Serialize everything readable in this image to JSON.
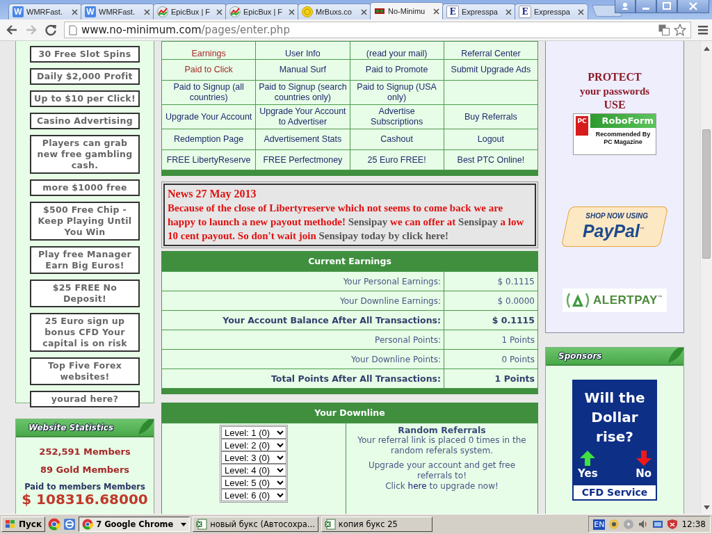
{
  "browser": {
    "tabs": [
      {
        "title": "WMRFast.",
        "kind": "letter",
        "favicon_text": "W",
        "selected": false
      },
      {
        "title": "WMRFast.",
        "kind": "letter",
        "favicon_text": "W",
        "selected": false
      },
      {
        "title": "EpicBux | F",
        "kind": "chart",
        "selected": false
      },
      {
        "title": "EpicBux | F",
        "kind": "chart",
        "selected": false
      },
      {
        "title": "MrBuxs.co",
        "kind": "coin",
        "selected": false
      },
      {
        "title": "No-Minimu",
        "kind": "flag",
        "selected": true
      },
      {
        "title": "Expresspa",
        "kind": "serif",
        "favicon_text": "E",
        "selected": false
      },
      {
        "title": "Expresspa",
        "kind": "serif",
        "favicon_text": "E",
        "selected": false
      }
    ],
    "back_enabled": true,
    "forward_enabled": false,
    "url_host": "www.no-minimum.com",
    "url_path": "/pages/enter.php"
  },
  "left_ads": [
    "30 Free Slot Spins",
    "Daily $2,000 Profit",
    "Up to $10 per Click!",
    "Casino Advertising",
    "Players can grab new free gambling cash.",
    "more $1000 free",
    "$500 Free Chip - Keep Playing Until You Win",
    "Play free Manager Earn Big Euros!",
    "$25 FREE No Deposit!",
    "25 Euro sign up bonus CFD Your capital is on risk",
    "Top Five Forex websites!",
    "yourad here?"
  ],
  "stats": {
    "title": "Website Statistics",
    "members": "252,591 Members",
    "gold": "89 Gold Members",
    "paid_label": "Paid to members Members",
    "paid_value": "$ 108316.68000"
  },
  "nav": {
    "rows": [
      [
        {
          "kind": "link",
          "text": "Earnings",
          "visited": true
        },
        {
          "kind": "link",
          "text": "User Info",
          "visited": false
        },
        {
          "kind": "link",
          "text": "(read your mail)",
          "visited": false
        },
        {
          "kind": "link",
          "text": "Referral Center",
          "visited": false
        }
      ],
      [
        {
          "kind": "link",
          "text": "Paid to Click",
          "visited": true
        },
        {
          "kind": "link",
          "text": "Manual Surf",
          "visited": false
        },
        {
          "kind": "link",
          "text": "Paid to Promote",
          "visited": false
        },
        {
          "kind": "link",
          "text": "Submit Upgrade Ads",
          "visited": false
        }
      ],
      [
        {
          "kind": "link",
          "text": "Paid to Signup (all countries)",
          "visited": false
        },
        {
          "kind": "link",
          "text": "Paid to Signup (search countries only)",
          "visited": false
        },
        {
          "kind": "link",
          "text": "Paid to Signup (USA only)",
          "visited": false
        },
        {
          "kind": "blank"
        }
      ],
      [
        {
          "kind": "link",
          "text": "Upgrade Your Account",
          "visited": false
        },
        {
          "kind": "link",
          "text": "Upgrade Your Account to Advertiser",
          "visited": false
        },
        {
          "kind": "link",
          "text": "Advertise Subscriptions",
          "visited": false
        },
        {
          "kind": "link",
          "text": "Buy Referrals",
          "visited": false
        }
      ],
      [
        {
          "kind": "link",
          "text": "Redemption Page",
          "visited": false
        },
        {
          "kind": "link",
          "text": "Advertisement Stats",
          "visited": false
        },
        {
          "kind": "link",
          "text": "Cashout",
          "visited": false
        },
        {
          "kind": "link",
          "text": "Logout",
          "visited": false
        }
      ],
      [
        {
          "kind": "link",
          "text": "FREE LibertyReserve",
          "visited": false
        },
        {
          "kind": "link",
          "text": "FREE Perfectmoney",
          "visited": false
        },
        {
          "kind": "link",
          "text": "25 Euro FREE!",
          "visited": false
        },
        {
          "kind": "link",
          "text": "Best PTC Online!",
          "visited": false
        }
      ]
    ]
  },
  "news": {
    "title": "News 27 May 2013",
    "segments": [
      {
        "kind": "alert",
        "text": "Because of the close of Libertyreserve which not seems to come back we are happy to launch a new payout methode! "
      },
      {
        "kind": "link",
        "text": "Sensipay"
      },
      {
        "kind": "alert",
        "text": " we can offer at "
      },
      {
        "kind": "link",
        "text": "Sensipay"
      },
      {
        "kind": "alert",
        "text": " a low 10 cent payout. So don't wait join "
      },
      {
        "kind": "link",
        "text": "Sensipay today by click here!"
      }
    ]
  },
  "earnings": {
    "title": "Current Earnings",
    "rows": [
      {
        "label": "Your Personal Earnings:",
        "value": "$ 0.1115",
        "total": false
      },
      {
        "label": "Your Downline Earnings:",
        "value": "$ 0.0000",
        "total": false
      },
      {
        "label": "Your Account Balance After All Transactions:",
        "value": "$ 0.1115",
        "total": true
      },
      {
        "label": "Personal Points:",
        "value": "1 Points",
        "total": false
      },
      {
        "label": "Your Downline Points:",
        "value": "0 Points",
        "total": false
      },
      {
        "label": "Total Points After All Transactions:",
        "value": "1 Points",
        "total": true
      }
    ]
  },
  "downline": {
    "title": "Your Downline",
    "levels": [
      "Level: 1 (0)",
      "Level: 2 (0)",
      "Level: 3 (0)",
      "Level: 4 (0)",
      "Level: 5 (0)",
      "Level: 6 (0)"
    ],
    "random": {
      "title": "Random Referrals",
      "text": "Your referral link is placed 0 times in the random referals system.",
      "upgrade": "Upgrade your account and get free referrals to!",
      "click_before": "Click ",
      "click_link": "here",
      "click_after": " to upgrade now!"
    }
  },
  "right": {
    "protect": [
      "PROTECT",
      "your passwords",
      "USE"
    ],
    "roboform": {
      "badge": "PC",
      "brand": "RoboForm",
      "text": "Recommended By PC Magazine"
    },
    "paypal": {
      "top": "SHOP NOW USING",
      "brand": "PayPal",
      "tm": "™"
    },
    "alertpay": {
      "brand": "ALERTPAY",
      "tm": "™"
    },
    "sponsors": {
      "title": "Sponsors",
      "question": "Will the Dollar rise?",
      "yes": "Yes",
      "no": "No",
      "footer": "CFD Service"
    }
  },
  "taskbar": {
    "start": "Пуск",
    "tasks": [
      {
        "label": "7 Google Chrome",
        "kind": "browser",
        "selected": true
      },
      {
        "label": "новый букс (Автосохра...",
        "kind": "spreadsheet",
        "selected": false
      },
      {
        "label": "копия букс 25",
        "kind": "spreadsheet",
        "selected": false
      }
    ],
    "language": "EN",
    "clock": "12:38"
  }
}
